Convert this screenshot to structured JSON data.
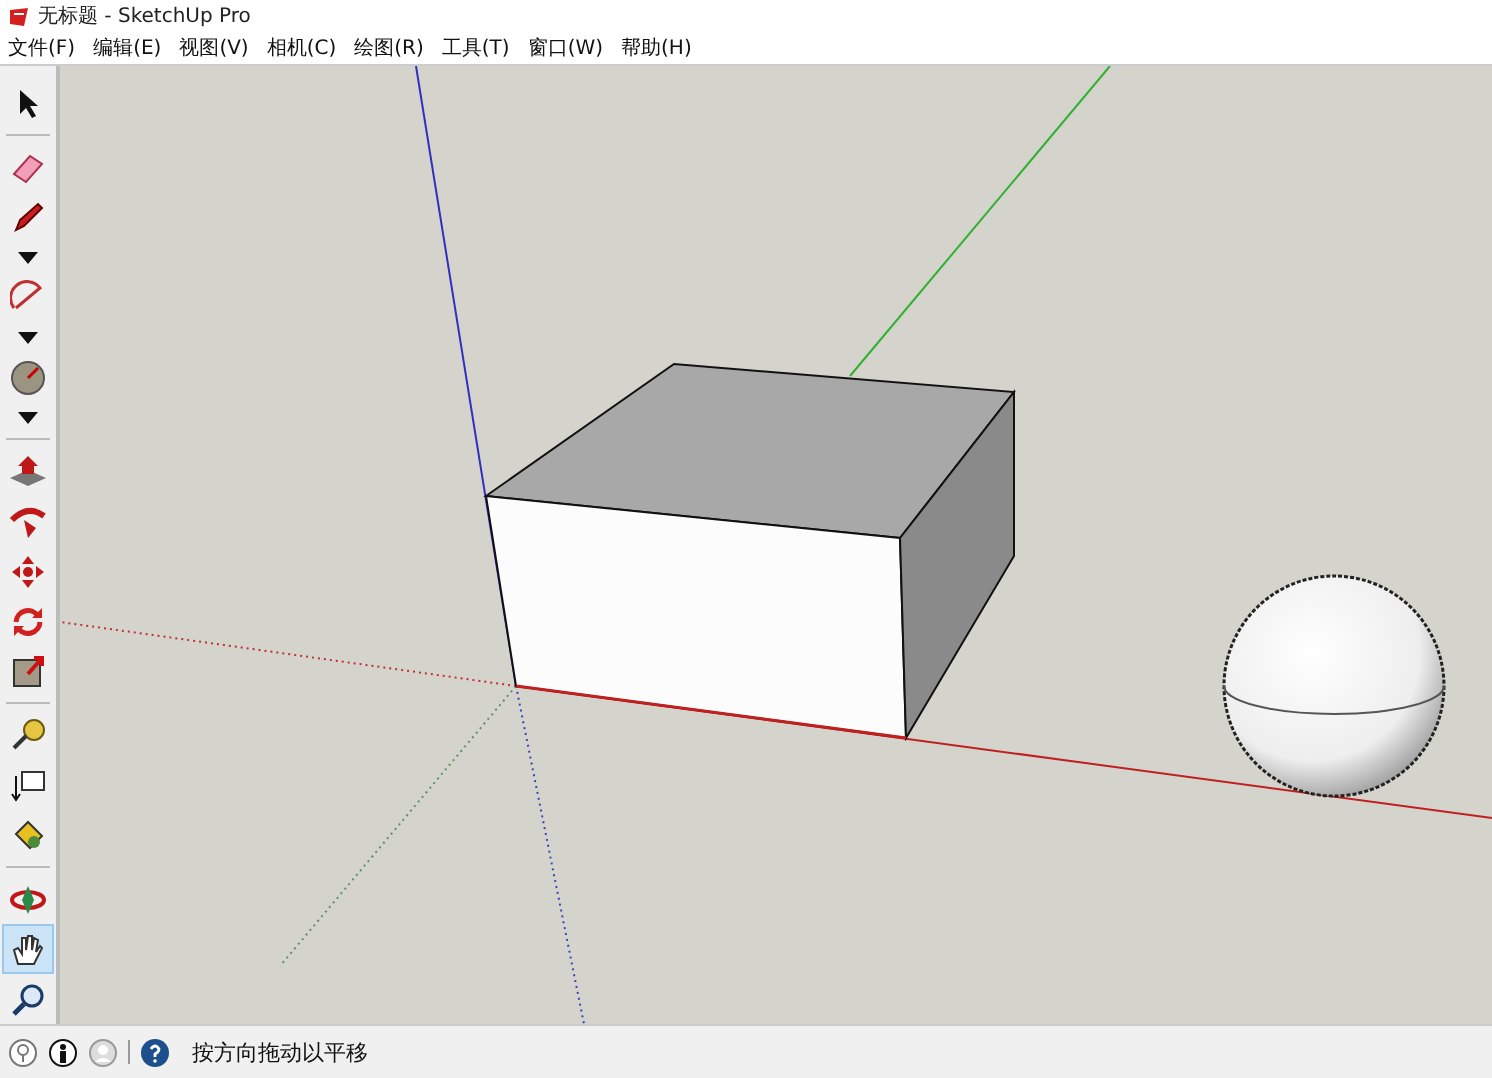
{
  "window": {
    "title": "无标题 - SketchUp Pro"
  },
  "menu": [
    "文件(F)",
    "编辑(E)",
    "视图(V)",
    "相机(C)",
    "绘图(R)",
    "工具(T)",
    "窗口(W)",
    "帮助(H)"
  ],
  "toolbar": [
    {
      "kind": "select",
      "selected": false
    },
    {
      "kind": "sep"
    },
    {
      "kind": "eraser",
      "selected": false
    },
    {
      "kind": "pencil",
      "selected": false
    },
    {
      "kind": "dropdown",
      "selected": false
    },
    {
      "kind": "arc",
      "selected": false
    },
    {
      "kind": "dropdown",
      "selected": false
    },
    {
      "kind": "protractor",
      "selected": false
    },
    {
      "kind": "dropdown",
      "selected": false
    },
    {
      "kind": "sep"
    },
    {
      "kind": "pushpull",
      "selected": false
    },
    {
      "kind": "followme",
      "selected": false
    },
    {
      "kind": "move",
      "selected": false
    },
    {
      "kind": "rotate",
      "selected": false
    },
    {
      "kind": "scale",
      "selected": false
    },
    {
      "kind": "sep"
    },
    {
      "kind": "tape",
      "selected": false
    },
    {
      "kind": "text",
      "selected": false
    },
    {
      "kind": "paint",
      "selected": false
    },
    {
      "kind": "sep"
    },
    {
      "kind": "orbit",
      "selected": false
    },
    {
      "kind": "pan",
      "selected": true
    },
    {
      "kind": "zoom",
      "selected": false
    }
  ],
  "status_bar": {
    "message": "按方向拖动以平移"
  }
}
